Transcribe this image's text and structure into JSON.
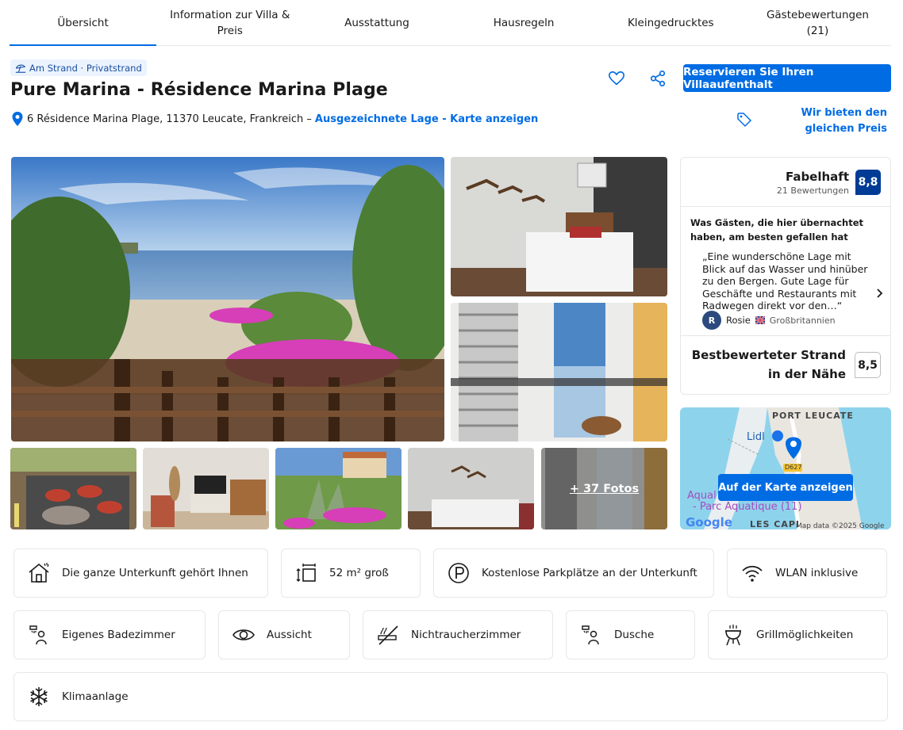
{
  "tabs": [
    {
      "label": "Übersicht"
    },
    {
      "label": "Information zur Villa & Preis"
    },
    {
      "label": "Ausstattung"
    },
    {
      "label": "Hausregeln"
    },
    {
      "label": "Kleingedrucktes"
    },
    {
      "label": "Gästebewertungen (21)"
    }
  ],
  "header": {
    "badge": "Am Strand · Privatstrand",
    "title": "Pure Marina - Résidence Marina Plage",
    "address": "6 Résidence Marina Plage, 11370 Leucate, Frankreich –",
    "location_link": "Ausgezeichnete Lage - Karte anzeigen",
    "reserve_button": "Reservieren Sie Ihren Villaaufenthalt",
    "price_match": "Wir bieten den gleichen Preis",
    "icons": {
      "favorite": "heart-icon",
      "share": "share-icon"
    }
  },
  "gallery": {
    "more_photos": "+ 37 Fotos"
  },
  "review": {
    "word": "Fabelhaft",
    "count": "21 Bewertungen",
    "score": "8,8",
    "heading": "Was Gästen, die hier übernachtet haben, am besten gefallen hat",
    "quote": "„Eine wunderschöne Lage mit Blick auf das Wasser und hinüber zu den Bergen. Gute Lage für Geschäfte und Restaurants mit Radwegen direkt vor den…“",
    "reviewer_initial": "R",
    "reviewer_name": "Rosie",
    "reviewer_country": "Großbritannien",
    "beach_label": "Bestbewerteter Strand in der Nähe",
    "beach_score": "8,5"
  },
  "map": {
    "button": "Auf der Karte anzeigen",
    "place1": "PORT LEUCATE",
    "place2": "Lidl",
    "place3": "Aqual",
    "place4": "- Parc Aquatique (11)",
    "place5": "LES CAPI",
    "road": "D627",
    "provider": "Google",
    "credit": "Map data ©2025 Google"
  },
  "facilities": [
    {
      "label": "Die ganze Unterkunft gehört Ihnen",
      "icon": "house-icon"
    },
    {
      "label": "52 m² groß",
      "icon": "size-icon"
    },
    {
      "label": "Kostenlose Parkplätze an der Unterkunft",
      "icon": "parking-icon"
    },
    {
      "label": "WLAN inklusive",
      "icon": "wifi-icon"
    },
    {
      "label": "Eigenes Badezimmer",
      "icon": "bathroom-icon"
    },
    {
      "label": "Aussicht",
      "icon": "eye-icon"
    },
    {
      "label": "Nichtraucherzimmer",
      "icon": "no-smoking-icon"
    },
    {
      "label": "Dusche",
      "icon": "shower-icon"
    },
    {
      "label": "Grillmöglichkeiten",
      "icon": "grill-icon"
    },
    {
      "label": "Klimaanlage",
      "icon": "snowflake-icon"
    }
  ]
}
